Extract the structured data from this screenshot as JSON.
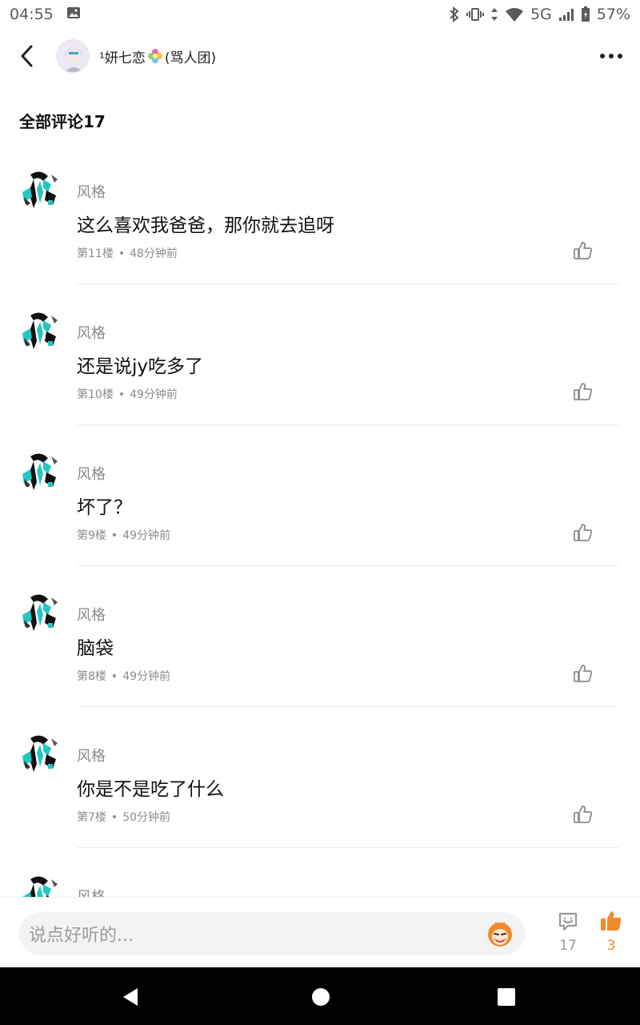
{
  "status_bar": {
    "time": "04:55",
    "network": "5G",
    "battery": "57%"
  },
  "header": {
    "title_prefix": "¹妍七恋",
    "title_suffix": "(骂人团)"
  },
  "section": {
    "title": "全部评论17"
  },
  "comments": [
    {
      "user": "风格",
      "text": "这么喜欢我爸爸，那你就去追呀",
      "floor": "第11楼",
      "time": "48分钟前"
    },
    {
      "user": "风格",
      "text": "还是说jy吃多了",
      "floor": "第10楼",
      "time": "49分钟前"
    },
    {
      "user": "风格",
      "text": "坏了？",
      "floor": "第9楼",
      "time": "49分钟前"
    },
    {
      "user": "风格",
      "text": "脑袋",
      "floor": "第8楼",
      "time": "49分钟前"
    },
    {
      "user": "风格",
      "text": "你是不是吃了什么",
      "floor": "第7楼",
      "time": "50分钟前"
    },
    {
      "user": "风格",
      "text": "",
      "floor": "",
      "time": ""
    }
  ],
  "meta_separator": "•",
  "bottom_bar": {
    "placeholder": "说点好听的...",
    "comment_count": "17",
    "like_count": "3"
  },
  "colors": {
    "accent": "#f28a2b",
    "avatar_teal": "#22c7c4"
  }
}
